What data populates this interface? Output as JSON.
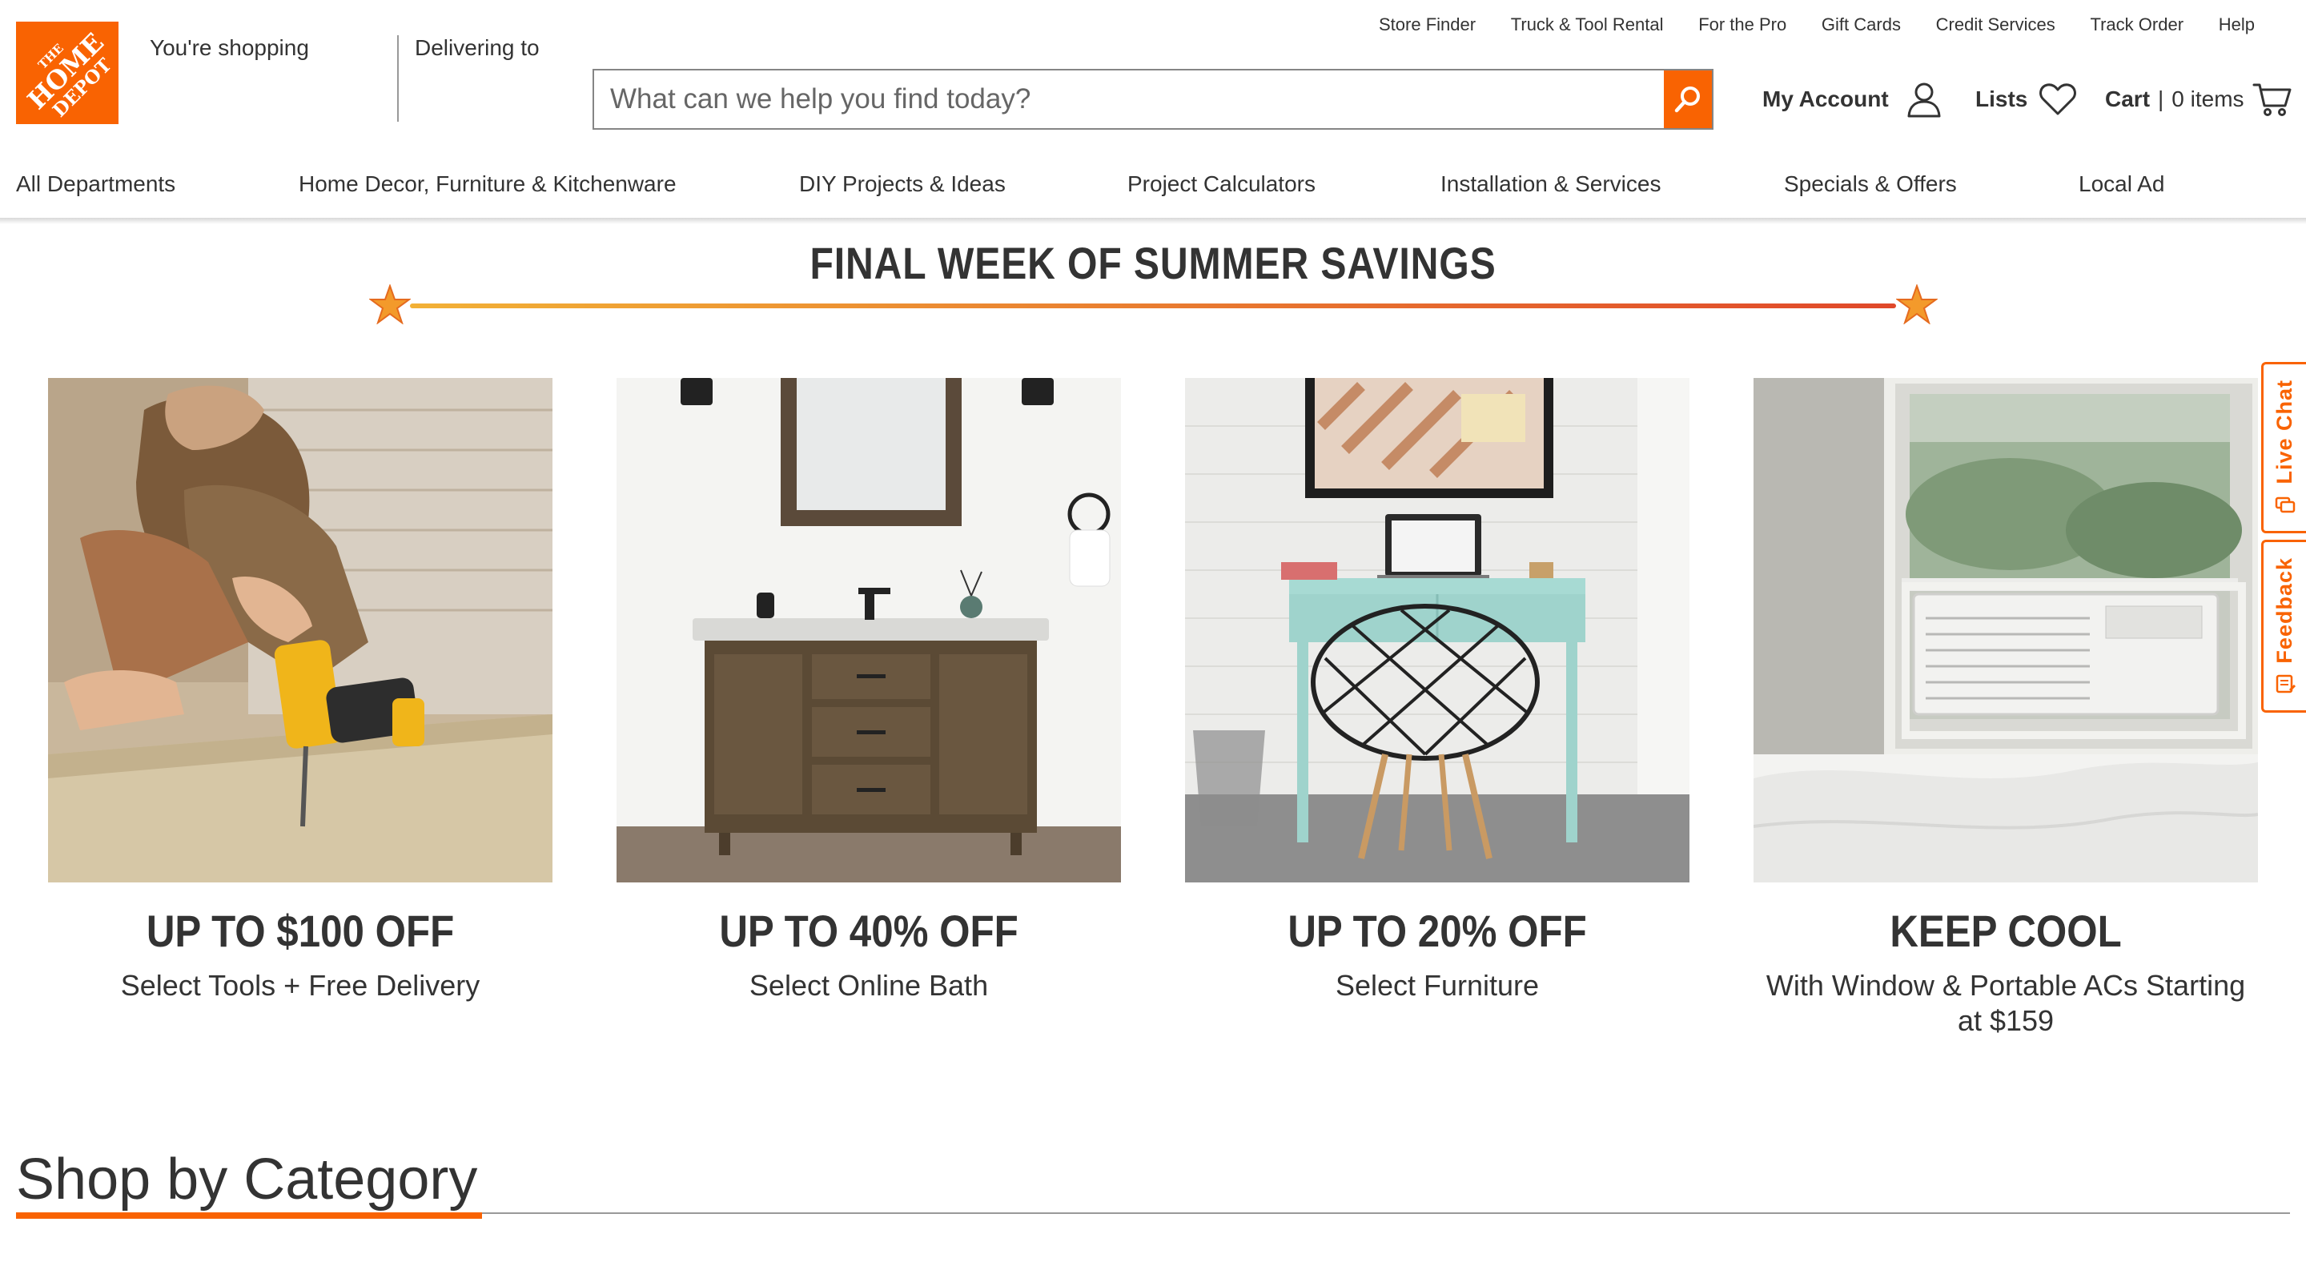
{
  "brand": {
    "logo_text": "THE HOME DEPOT",
    "logo_color": "#f96302"
  },
  "location": {
    "shopping_label": "You're shopping",
    "delivering_label": "Delivering to"
  },
  "utility_nav": [
    "Store Finder",
    "Truck & Tool Rental",
    "For the Pro",
    "Gift Cards",
    "Credit Services",
    "Track Order",
    "Help"
  ],
  "search": {
    "placeholder": "What can we help you find today?",
    "value": "",
    "icon": "search-icon"
  },
  "account": {
    "label": "My Account",
    "icon": "user-icon"
  },
  "lists": {
    "label": "Lists",
    "icon": "heart-icon"
  },
  "cart": {
    "label": "Cart",
    "separator": "|",
    "count_text": "0 items",
    "icon": "cart-icon"
  },
  "main_nav": [
    "All Departments",
    "Home Decor, Furniture & Kitchenware",
    "DIY Projects & Ideas",
    "Project Calculators",
    "Installation & Services",
    "Specials & Offers",
    "Local Ad"
  ],
  "banner": {
    "title": "FINAL WEEK OF SUMMER SAVINGS",
    "icon": "star-icon"
  },
  "promos": [
    {
      "title": "UP TO $100 OFF",
      "subtitle": "Select Tools + Free Delivery",
      "image": "man-using-drill"
    },
    {
      "title": "UP TO 40% OFF",
      "subtitle": "Select Online Bath",
      "image": "bathroom-vanity"
    },
    {
      "title": "UP TO 20% OFF",
      "subtitle": "Select Furniture",
      "image": "desk-and-chair"
    },
    {
      "title": "KEEP COOL",
      "subtitle": "With Window & Portable ACs Starting at $159",
      "image": "window-air-conditioner"
    }
  ],
  "side_tabs": {
    "live_chat": "Live Chat",
    "feedback": "Feedback"
  },
  "shop_by_category": {
    "title": "Shop by Category"
  },
  "colors": {
    "accent": "#f96302",
    "text": "#333333",
    "border": "#858585"
  }
}
